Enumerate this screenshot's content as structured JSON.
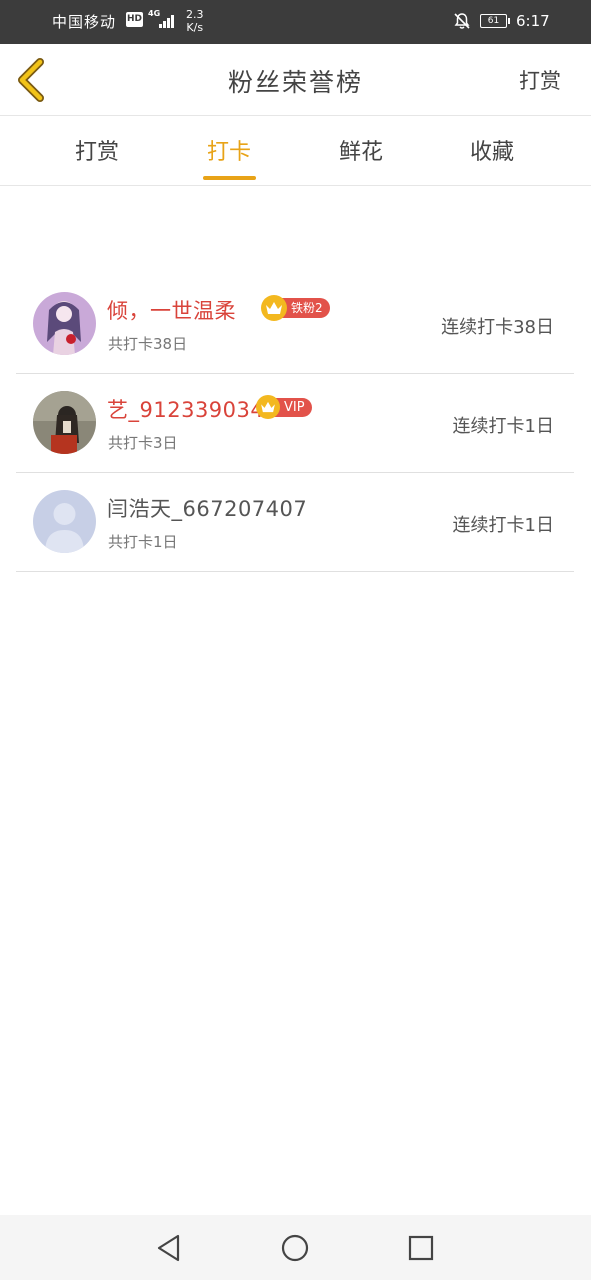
{
  "status_bar": {
    "carrier": "中国移动",
    "hd": "HD",
    "network": "4G",
    "speed_value": "2.3",
    "speed_unit": "K/s",
    "battery": "61",
    "time": "6:17"
  },
  "header": {
    "title": "粉丝荣誉榜",
    "action_label": "打赏"
  },
  "tabs": [
    {
      "label": "打赏",
      "active": false
    },
    {
      "label": "打卡",
      "active": true
    },
    {
      "label": "鲜花",
      "active": false
    },
    {
      "label": "收藏",
      "active": false
    }
  ],
  "accent_color": "#e8a317",
  "rows": [
    {
      "name": "倾，一世温柔",
      "total": "共打卡38日",
      "streak": "连续打卡38日",
      "badge": "铁粉2",
      "avatar": "anime-girl-avatar"
    },
    {
      "name": "艺_912339034",
      "total": "共打卡3日",
      "streak": "连续打卡1日",
      "badge": "VIP",
      "avatar": "photo-avatar"
    },
    {
      "name": "闫浩天_667207407",
      "total": "共打卡1日",
      "streak": "连续打卡1日",
      "badge": "",
      "avatar": "default-user-avatar"
    }
  ],
  "nav": {
    "back": "back-triangle-icon",
    "home": "home-circle-icon",
    "recent": "recent-square-icon"
  }
}
